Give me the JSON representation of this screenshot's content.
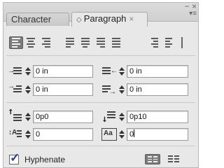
{
  "tabs": [
    {
      "label": "Character"
    },
    {
      "label": "Paragraph",
      "close": "×"
    }
  ],
  "window": {
    "close_glyph": "×"
  },
  "alignment": {
    "buttons": [
      "align-left",
      "align-center",
      "align-right",
      "justify-left",
      "justify-center",
      "justify-right",
      "justify-all",
      "align-toward-spine",
      "align-away-from-spine"
    ],
    "selected": "align-left"
  },
  "indents": {
    "left_indent": "0 in",
    "right_indent": "0 in",
    "first_line_indent": "0 in",
    "last_line_indent": "0 in"
  },
  "spacing": {
    "space_before": "0p0",
    "space_after": "0p10",
    "drop_cap_lines": "0",
    "drop_cap_chars": "0"
  },
  "hyphenate": {
    "label": "Hyphenate",
    "checked": true
  },
  "colors": {
    "panel": "#e8e8e8",
    "check": "#2a3e9a"
  }
}
